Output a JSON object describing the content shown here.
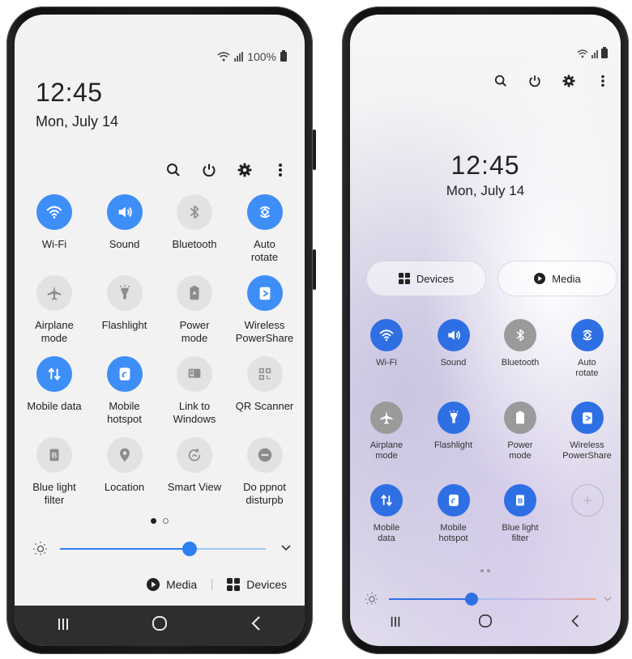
{
  "left_phone": {
    "status": {
      "battery_text": "100%"
    },
    "clock": "12:45",
    "date": "Mon, July 14",
    "toolbar_icons": [
      "search-icon",
      "power-icon",
      "settings-icon",
      "more-icon"
    ],
    "tiles": [
      {
        "label": "Wi-Fi",
        "icon": "wifi-icon",
        "active": true
      },
      {
        "label": "Sound",
        "icon": "sound-icon",
        "active": true
      },
      {
        "label": "Bluetooth",
        "icon": "bluetooth-icon",
        "active": false
      },
      {
        "label": "Auto\nrotate",
        "icon": "auto-rotate-icon",
        "active": true
      },
      {
        "label": "Airplane\nmode",
        "icon": "airplane-icon",
        "active": false
      },
      {
        "label": "Flashlight",
        "icon": "flashlight-icon",
        "active": false
      },
      {
        "label": "Power\nmode",
        "icon": "power-mode-icon",
        "active": false
      },
      {
        "label": "Wireless\nPowerShare",
        "icon": "wireless-powershare-icon",
        "active": true
      },
      {
        "label": "Mobile data",
        "icon": "mobile-data-icon",
        "active": true
      },
      {
        "label": "Mobile\nhotspot",
        "icon": "hotspot-icon",
        "active": true
      },
      {
        "label": "Link to\nWindows",
        "icon": "link-to-windows-icon",
        "active": false
      },
      {
        "label": "QR Scanner",
        "icon": "qr-scanner-icon",
        "active": false
      },
      {
        "label": "Blue light\nfilter",
        "icon": "blue-light-icon",
        "active": false
      },
      {
        "label": "Location",
        "icon": "location-icon",
        "active": false
      },
      {
        "label": "Smart View",
        "icon": "smart-view-icon",
        "active": false
      },
      {
        "label": "Do ppnot\ndisturpb",
        "icon": "do-not-disturb-icon",
        "active": false
      }
    ],
    "page_indicator": {
      "pages": 2,
      "current": 1
    },
    "brightness": 0.63,
    "media_label": "Media",
    "devices_label": "Devices",
    "nav": [
      "recents-icon",
      "home-icon",
      "back-icon"
    ]
  },
  "right_phone": {
    "clock": "12:45",
    "date": "Mon, July 14",
    "toolbar_icons": [
      "search-icon",
      "power-icon",
      "settings-icon",
      "more-icon"
    ],
    "devices_label": "Devices",
    "media_label": "Media",
    "tiles": [
      {
        "label": "Wi-Fi",
        "icon": "wifi-icon",
        "active": true
      },
      {
        "label": "Sound",
        "icon": "sound-icon",
        "active": true
      },
      {
        "label": "Bluetooth",
        "icon": "bluetooth-icon",
        "active": false
      },
      {
        "label": "Auto\nrotate",
        "icon": "auto-rotate-icon",
        "active": true
      },
      {
        "label": "Airplane\nmode",
        "icon": "airplane-icon",
        "active": false
      },
      {
        "label": "Flashlight",
        "icon": "flashlight-icon",
        "active": true
      },
      {
        "label": "Power\nmode",
        "icon": "power-mode-icon",
        "active": false
      },
      {
        "label": "Wireless\nPowerShare",
        "icon": "wireless-powershare-icon",
        "active": true
      },
      {
        "label": "Mobile\ndata",
        "icon": "mobile-data-icon",
        "active": true
      },
      {
        "label": "Mobile\nhotspot",
        "icon": "hotspot-icon",
        "active": true
      },
      {
        "label": "Blue light\nfilter",
        "icon": "blue-light-icon",
        "active": true
      },
      {
        "label": "",
        "icon": "add-icon",
        "active": false
      }
    ],
    "page_indicator": {
      "pages": 2,
      "current": 1
    },
    "brightness": 0.4,
    "nav": [
      "recents-icon",
      "home-icon",
      "back-icon"
    ]
  },
  "colors": {
    "accent": "#3e8ef7",
    "accent_dark": "#2f6fe4",
    "inactive": "#e2e2e2",
    "navbar": "#2e2e2e"
  }
}
